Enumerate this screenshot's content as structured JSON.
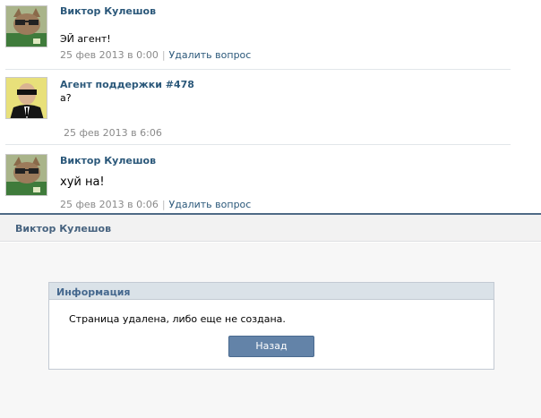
{
  "messages": [
    {
      "author": "Виктор Кулешов",
      "text": "ЭЙ агент!",
      "date": "25 фев 2013 в 0:00",
      "separator": "|",
      "delete_label": "Удалить вопрос",
      "avatar_icon": "cat-avatar-icon"
    },
    {
      "author": "Агент поддержки #478",
      "text": "а?",
      "date": "25 фев 2013 в 6:06",
      "avatar_icon": "agent-in-suit-avatar-icon"
    },
    {
      "author": "Виктор Кулешов",
      "text": "хуй на!",
      "date": "25 фев 2013 в 0:06",
      "separator": "|",
      "delete_label": "Удалить вопрос",
      "avatar_icon": "cat-avatar-icon"
    }
  ],
  "panel": {
    "title": "Виктор Кулешов",
    "info_box": {
      "title": "Информация",
      "message": "Страница удалена, либо еще не создана.",
      "back_button": "Назад"
    }
  },
  "colors": {
    "link": "#2b587a",
    "header_accent": "#4f6a86",
    "button": "#6383a8"
  }
}
